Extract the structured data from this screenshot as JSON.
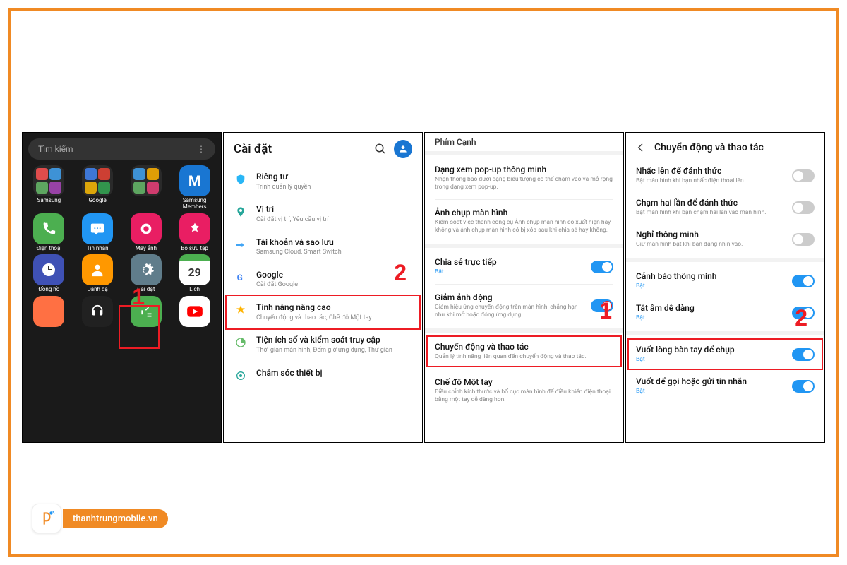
{
  "p1": {
    "search_placeholder": "Tìm kiếm",
    "apps": [
      {
        "label": "Samsung",
        "type": "folder",
        "colors": [
          "#ff5252",
          "#42a5f5",
          "#66bb6a",
          "#ab47bc"
        ]
      },
      {
        "label": "Google",
        "type": "folder",
        "colors": [
          "#4285f4",
          "#ea4335",
          "#fbbc05",
          "#34a853"
        ]
      },
      {
        "label": "",
        "type": "folder",
        "colors": [
          "#42a5f5",
          "#ffb300",
          "#66bb6a",
          "#ec407a"
        ]
      },
      {
        "label": "Samsung Members",
        "bg": "#1976D2",
        "char": "M"
      },
      {
        "label": "Điện thoại",
        "bg": "#4CAF50",
        "icon": "phone"
      },
      {
        "label": "Tin nhắn",
        "bg": "#2196F3",
        "icon": "msg"
      },
      {
        "label": "Máy ảnh",
        "bg": "#E91E63",
        "icon": "camera"
      },
      {
        "label": "Bộ sưu tập",
        "bg": "#E91E63",
        "icon": "gallery"
      },
      {
        "label": "Đồng hồ",
        "bg": "#3F51B5",
        "icon": "clock"
      },
      {
        "label": "Danh bạ",
        "bg": "#FF9800",
        "icon": "contact"
      },
      {
        "label": "Cài đặt",
        "bg": "#607D8B",
        "icon": "gear"
      },
      {
        "label": "Lịch",
        "bg": "#4CAF50",
        "char": "29",
        "calendar": true
      },
      {
        "label": "",
        "bg": "#FF7043",
        "icon": "blank"
      },
      {
        "label": "",
        "bg": "#212121",
        "icon": "headset"
      },
      {
        "label": "",
        "bg": "#4CAF50",
        "icon": "calc"
      },
      {
        "label": "",
        "bg": "#FFFFFF",
        "icon": "youtube"
      }
    ],
    "step": "1"
  },
  "p2": {
    "title": "Cài đặt",
    "step": "2",
    "rows": [
      {
        "icon": "shield",
        "col": "#29B6F6",
        "title": "Riêng tư",
        "sub": "Trình quản lý quyền"
      },
      {
        "icon": "pin",
        "col": "#26A69A",
        "title": "Vị trí",
        "sub": "Cài đặt vị trí, Yêu cầu vị trí"
      },
      {
        "icon": "key",
        "col": "#42A5F5",
        "title": "Tài khoản và sao lưu",
        "sub": "Samsung Cloud, Smart Switch"
      },
      {
        "icon": "g",
        "col": "#4285F4",
        "title": "Google",
        "sub": "Cài đặt Google"
      },
      {
        "icon": "star",
        "col": "#FFB300",
        "title": "Tính năng nâng cao",
        "sub": "Chuyển động và thao tác, Chế độ Một tay",
        "hi": true
      },
      {
        "icon": "wellbeing",
        "col": "#66BB6A",
        "title": "Tiện ích số và kiểm soát truy cập",
        "sub": "Thời gian màn hình, Đếm giờ ứng dụng, Thư giãn"
      },
      {
        "icon": "care",
        "col": "#26A69A",
        "title": "Chăm sóc thiết bị",
        "sub": ""
      }
    ]
  },
  "p3": {
    "tab": "Phím Cạnh",
    "step": "1",
    "rows": [
      {
        "title": "Dạng xem pop-up thông minh",
        "sub": "Nhận thông báo dưới dạng biểu tượng có thể chạm vào và mở rộng trong dạng xem pop-up."
      },
      {
        "title": "Ảnh chụp màn hình",
        "sub": "Kiểm soát việc thanh công cụ Ảnh chụp màn hình có xuất hiện hay không và ảnh chụp màn hình có bị xóa sau khi chia sẻ hay không."
      },
      {
        "title": "Chia sẻ trực tiếp",
        "sub": "Bật",
        "toggle": "on"
      },
      {
        "title": "Giảm ảnh động",
        "sub": "Giảm hiệu ứng chuyển động trên màn hình, chẳng hạn như khi mở hoặc đóng ứng dụng.",
        "toggle": "onred"
      },
      {
        "title": "Chuyển động và thao tác",
        "sub": "Quản lý tính năng liên quan đến chuyển động và thao tác.",
        "hi": true
      },
      {
        "title": "Chế độ Một tay",
        "sub": "Điều chỉnh kích thước và bố cục màn hình để điều khiển điện thoại bằng một tay dễ dàng hơn."
      }
    ]
  },
  "p4": {
    "title": "Chuyển động và thao tác",
    "step": "2",
    "rows": [
      {
        "title": "Nhấc lên để đánh thức",
        "sub": "Bật màn hình khi bạn nhấc điện thoại lên.",
        "toggle": "off"
      },
      {
        "title": "Chạm hai lần để đánh thức",
        "sub": "Bật màn hình khi bạn chạm hai lần vào màn hình.",
        "toggle": "off"
      },
      {
        "title": "Nghỉ thông minh",
        "sub": "Giữ màn hình bật khi bạn đang nhìn vào.",
        "toggle": "off"
      },
      {
        "sep": true
      },
      {
        "title": "Cảnh báo thông minh",
        "sub": "Bật",
        "toggle": "on"
      },
      {
        "title": "Tắt âm dễ dàng",
        "sub": "Bật",
        "toggle": "on"
      },
      {
        "sep": true
      },
      {
        "title": "Vuốt lòng bàn tay để chụp",
        "sub": "Bật",
        "toggle": "on",
        "hi": true
      },
      {
        "title": "Vuốt để gọi hoặc gửi tin nhắn",
        "sub": "Bật",
        "toggle": "on"
      }
    ]
  },
  "brand": "thanhtrungmobile.vn"
}
